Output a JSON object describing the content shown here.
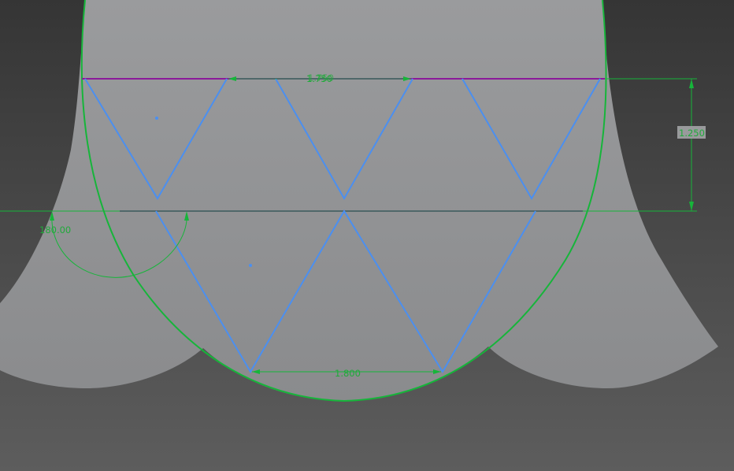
{
  "viewport": {
    "background_top": "#353535",
    "background_bottom": "#5b5b5b"
  },
  "colors": {
    "solid_body": "#8f9092",
    "constraint_green": "#16b53a",
    "sketch_blue": "#4b8ff0",
    "construction_purple": "#8b1a9a",
    "background": "#4a4a4a"
  },
  "dimensions": {
    "top_width": "1.750",
    "top_width_overlap": "1.750",
    "vertical_height": "1.250",
    "angle": "180.00",
    "bottom_width": "1.800"
  }
}
